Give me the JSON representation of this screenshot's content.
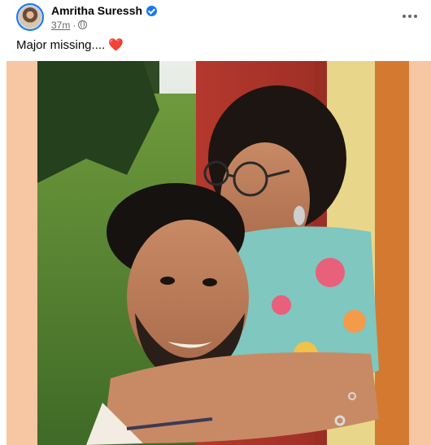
{
  "post": {
    "author": "Amritha Suressh",
    "verified": true,
    "time": "37m",
    "separator": "·",
    "audience_icon": "globe-icon",
    "more_icon": "more-options-icon",
    "caption_text": "Major missing....",
    "caption_emoji": "❤️"
  },
  "photo": {
    "background_color": "#f7c6a3",
    "description_icon": "photo"
  },
  "colors": {
    "verified": "#1877f2",
    "secondary_text": "#65676b",
    "primary_text": "#050505"
  }
}
